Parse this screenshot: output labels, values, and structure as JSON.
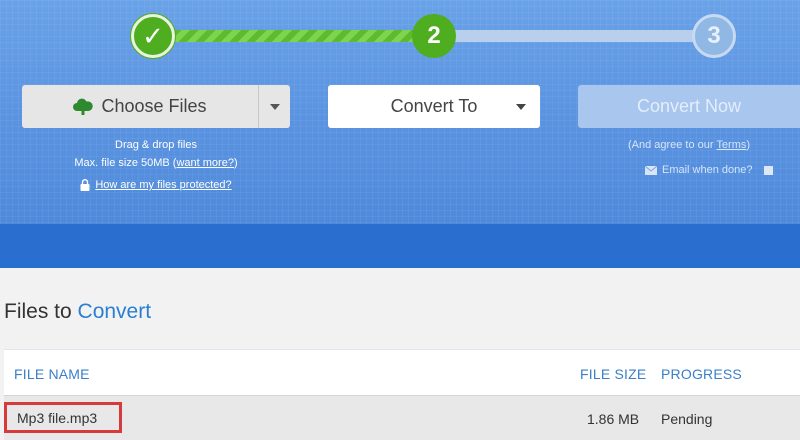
{
  "steps": [
    {
      "label": "✓",
      "state": "done"
    },
    {
      "label": "2",
      "state": "active"
    },
    {
      "label": "3",
      "state": "todo"
    }
  ],
  "toolbar": {
    "choose_files_label": "Choose Files",
    "convert_to_label": "Convert To",
    "convert_now_label": "Convert Now"
  },
  "upload_help": {
    "drag_drop": "Drag & drop files",
    "max_size_prefix": "Max. file size 50MB (",
    "want_more": "want more?",
    "max_size_suffix": ")",
    "protected_link": "How are my files protected?"
  },
  "convert_help": {
    "agree_prefix": "(And agree to our ",
    "terms_link": "Terms",
    "agree_suffix": ")",
    "email_label": "Email when done?"
  },
  "files_section": {
    "title_plain": "Files to ",
    "title_accent": "Convert",
    "columns": [
      "FILE NAME",
      "FILE SIZE",
      "PROGRESS"
    ],
    "rows": [
      {
        "name": "Mp3 file.mp3",
        "size": "1.86 MB",
        "progress": "Pending"
      }
    ]
  },
  "colors": {
    "hero_blue": "#5a93e0",
    "band_blue": "#2a6fd0",
    "step_green": "#4fae1f",
    "accent": "#2b7fd1",
    "highlight_red": "#d63a3a"
  },
  "icons": [
    "checkmark-icon",
    "cloud-upload-icon",
    "chevron-down-icon",
    "lock-icon",
    "mail-icon"
  ]
}
